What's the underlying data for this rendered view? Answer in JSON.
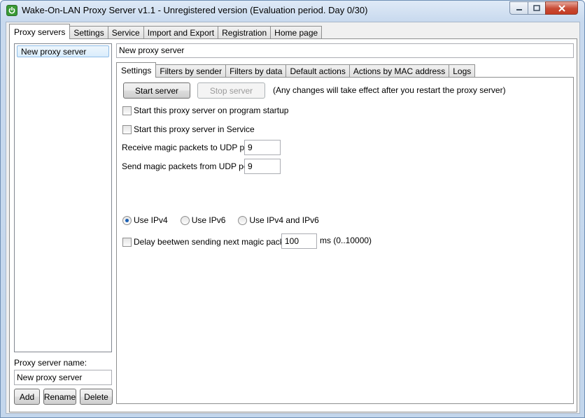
{
  "window": {
    "title": "Wake-On-LAN Proxy Server v1.1 - Unregistered version (Evaluation period. Day 0/30)"
  },
  "main_tabs": [
    {
      "label": "Proxy servers",
      "active": true
    },
    {
      "label": "Settings"
    },
    {
      "label": "Service"
    },
    {
      "label": "Import and Export"
    },
    {
      "label": "Registration"
    },
    {
      "label": "Home page"
    }
  ],
  "server_list": {
    "items": [
      {
        "label": "New proxy server",
        "selected": true
      }
    ]
  },
  "proxy_name": {
    "label": "Proxy server name:",
    "value": "New proxy server"
  },
  "list_buttons": {
    "add": "Add",
    "rename": "Rename",
    "delete": "Delete"
  },
  "selected_server_name": "New proxy server",
  "inner_tabs": [
    {
      "label": "Settings",
      "active": true
    },
    {
      "label": "Filters by sender"
    },
    {
      "label": "Filters by data"
    },
    {
      "label": "Default actions"
    },
    {
      "label": "Actions by MAC address"
    },
    {
      "label": "Logs"
    }
  ],
  "settings": {
    "start_button": "Start server",
    "stop_button": "Stop server",
    "restart_note": "(Any changes will take effect after you restart the proxy server)",
    "startup_checkbox": {
      "label": "Start this proxy server on program startup",
      "checked": false
    },
    "service_checkbox": {
      "label": "Start this proxy server in Service",
      "checked": false
    },
    "receive_port": {
      "label": "Receive magic packets to UDP port:",
      "value": "9"
    },
    "send_port": {
      "label": "Send magic packets from UDP port:",
      "value": "9"
    },
    "ip_options": [
      {
        "label": "Use IPv4",
        "checked": true
      },
      {
        "label": "Use IPv6",
        "checked": false
      },
      {
        "label": "Use IPv4 and IPv6",
        "checked": false
      }
    ],
    "delay": {
      "label": "Delay beetwen sending next magic packet:",
      "value": "100",
      "unit": "ms (0..10000)",
      "checked": false
    }
  },
  "colors": {
    "title_gradient_top": "#dfeaf7",
    "selection_border": "#8fbde8",
    "close_button": "#c74a34",
    "radio_dot": "#1a5fb4"
  }
}
